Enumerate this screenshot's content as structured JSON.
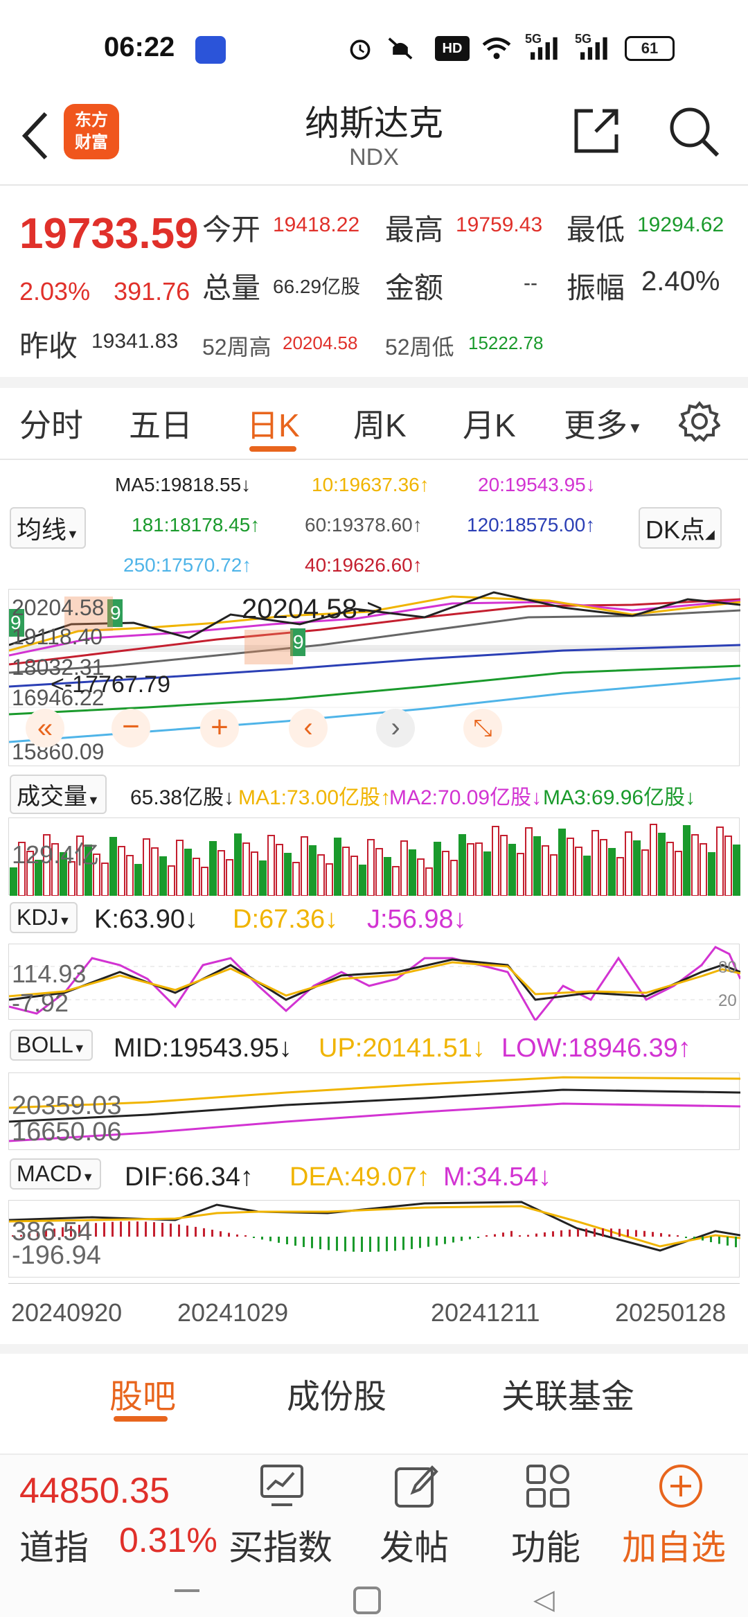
{
  "status_bar": {
    "time": "06:22",
    "network1": "5G",
    "network2": "5G",
    "hd": "HD",
    "battery": "61"
  },
  "header": {
    "title": "纳斯达克",
    "subtitle": "NDX",
    "logo_text_1": "东方",
    "logo_text_2": "财富",
    "icons": [
      "back-icon",
      "share-icon",
      "search-icon"
    ]
  },
  "quote": {
    "price": "19733.59",
    "change_pct": "2.03%",
    "change_amt": "391.76",
    "open_label": "今开",
    "open": "19418.22",
    "high_label": "最高",
    "high": "19759.43",
    "low_label": "最低",
    "low": "19294.62",
    "volume_label": "总量",
    "volume": "66.29亿股",
    "amount_label": "金额",
    "amount": "--",
    "amplitude_label": "振幅",
    "amplitude": "2.40%",
    "prev_close_label": "昨收",
    "prev_close": "19341.83",
    "w52_high_label": "52周高",
    "w52_high": "20204.58",
    "w52_low_label": "52周低",
    "w52_low": "15222.78"
  },
  "tabs": {
    "intraday": "分时",
    "five_day": "五日",
    "day_k": "日K",
    "week_k": "周K",
    "month_k": "月K",
    "more": "更多"
  },
  "ma_legend": {
    "select": "均线",
    "ma5": "MA5:19818.55↓",
    "ma10": "10:19637.36↑",
    "ma20": "20:19543.95↓",
    "ma181": "181:18178.45↑",
    "ma60": "60:19378.60↑",
    "ma120": "120:18575.00↑",
    "ma250": "250:17570.72↑",
    "ma40": "40:19626.60↑",
    "dk_button": "DK点"
  },
  "kline": {
    "y_labels": [
      "20204.58",
      "19118.40",
      "18032.31",
      "16946.22",
      "15860.09"
    ],
    "max_annotation": "20204.58->",
    "min_annotation": "<-17767.79",
    "signal_badge": "9"
  },
  "volume": {
    "select": "成交量",
    "value": "65.38亿股↓",
    "ma1": "MA1:73.00亿股↑",
    "ma2": "MA2:70.09亿股↓",
    "ma3": "MA3:69.96亿股↓",
    "axis_label": "129.4亿"
  },
  "kdj": {
    "select": "KDJ",
    "k": "K:63.90↓",
    "d": "D:67.36↓",
    "j": "J:56.98↓",
    "axis_top": "114.93",
    "axis_bottom": "-7.92",
    "right_top": "80",
    "right_bottom": "20"
  },
  "boll": {
    "select": "BOLL",
    "mid": "MID:19543.95↓",
    "up": "UP:20141.51↓",
    "low": "LOW:18946.39↑",
    "axis_top": "20359.03",
    "axis_bottom": "16650.06"
  },
  "macd": {
    "select": "MACD",
    "dif": "DIF:66.34↑",
    "dea": "DEA:49.07↑",
    "m": "M:34.54↓",
    "axis_top": "386.54",
    "axis_bottom": "-196.94"
  },
  "dates": [
    "20240920",
    "20241029",
    "20241211",
    "20250128"
  ],
  "bottom_tabs": {
    "guba": "股吧",
    "components": "成份股",
    "related_funds": "关联基金"
  },
  "bottom_nav": {
    "dji_price": "44850.35",
    "dji_name": "道指",
    "dji_change": "0.31%",
    "buy_index": "买指数",
    "post": "发帖",
    "functions": "功能",
    "add_watch": "加自选"
  },
  "colors": {
    "up": "#e0302a",
    "down": "#1a9a2c",
    "accent": "#e8651d",
    "ma10": "#f0b400",
    "ma20": "#d233d2"
  }
}
